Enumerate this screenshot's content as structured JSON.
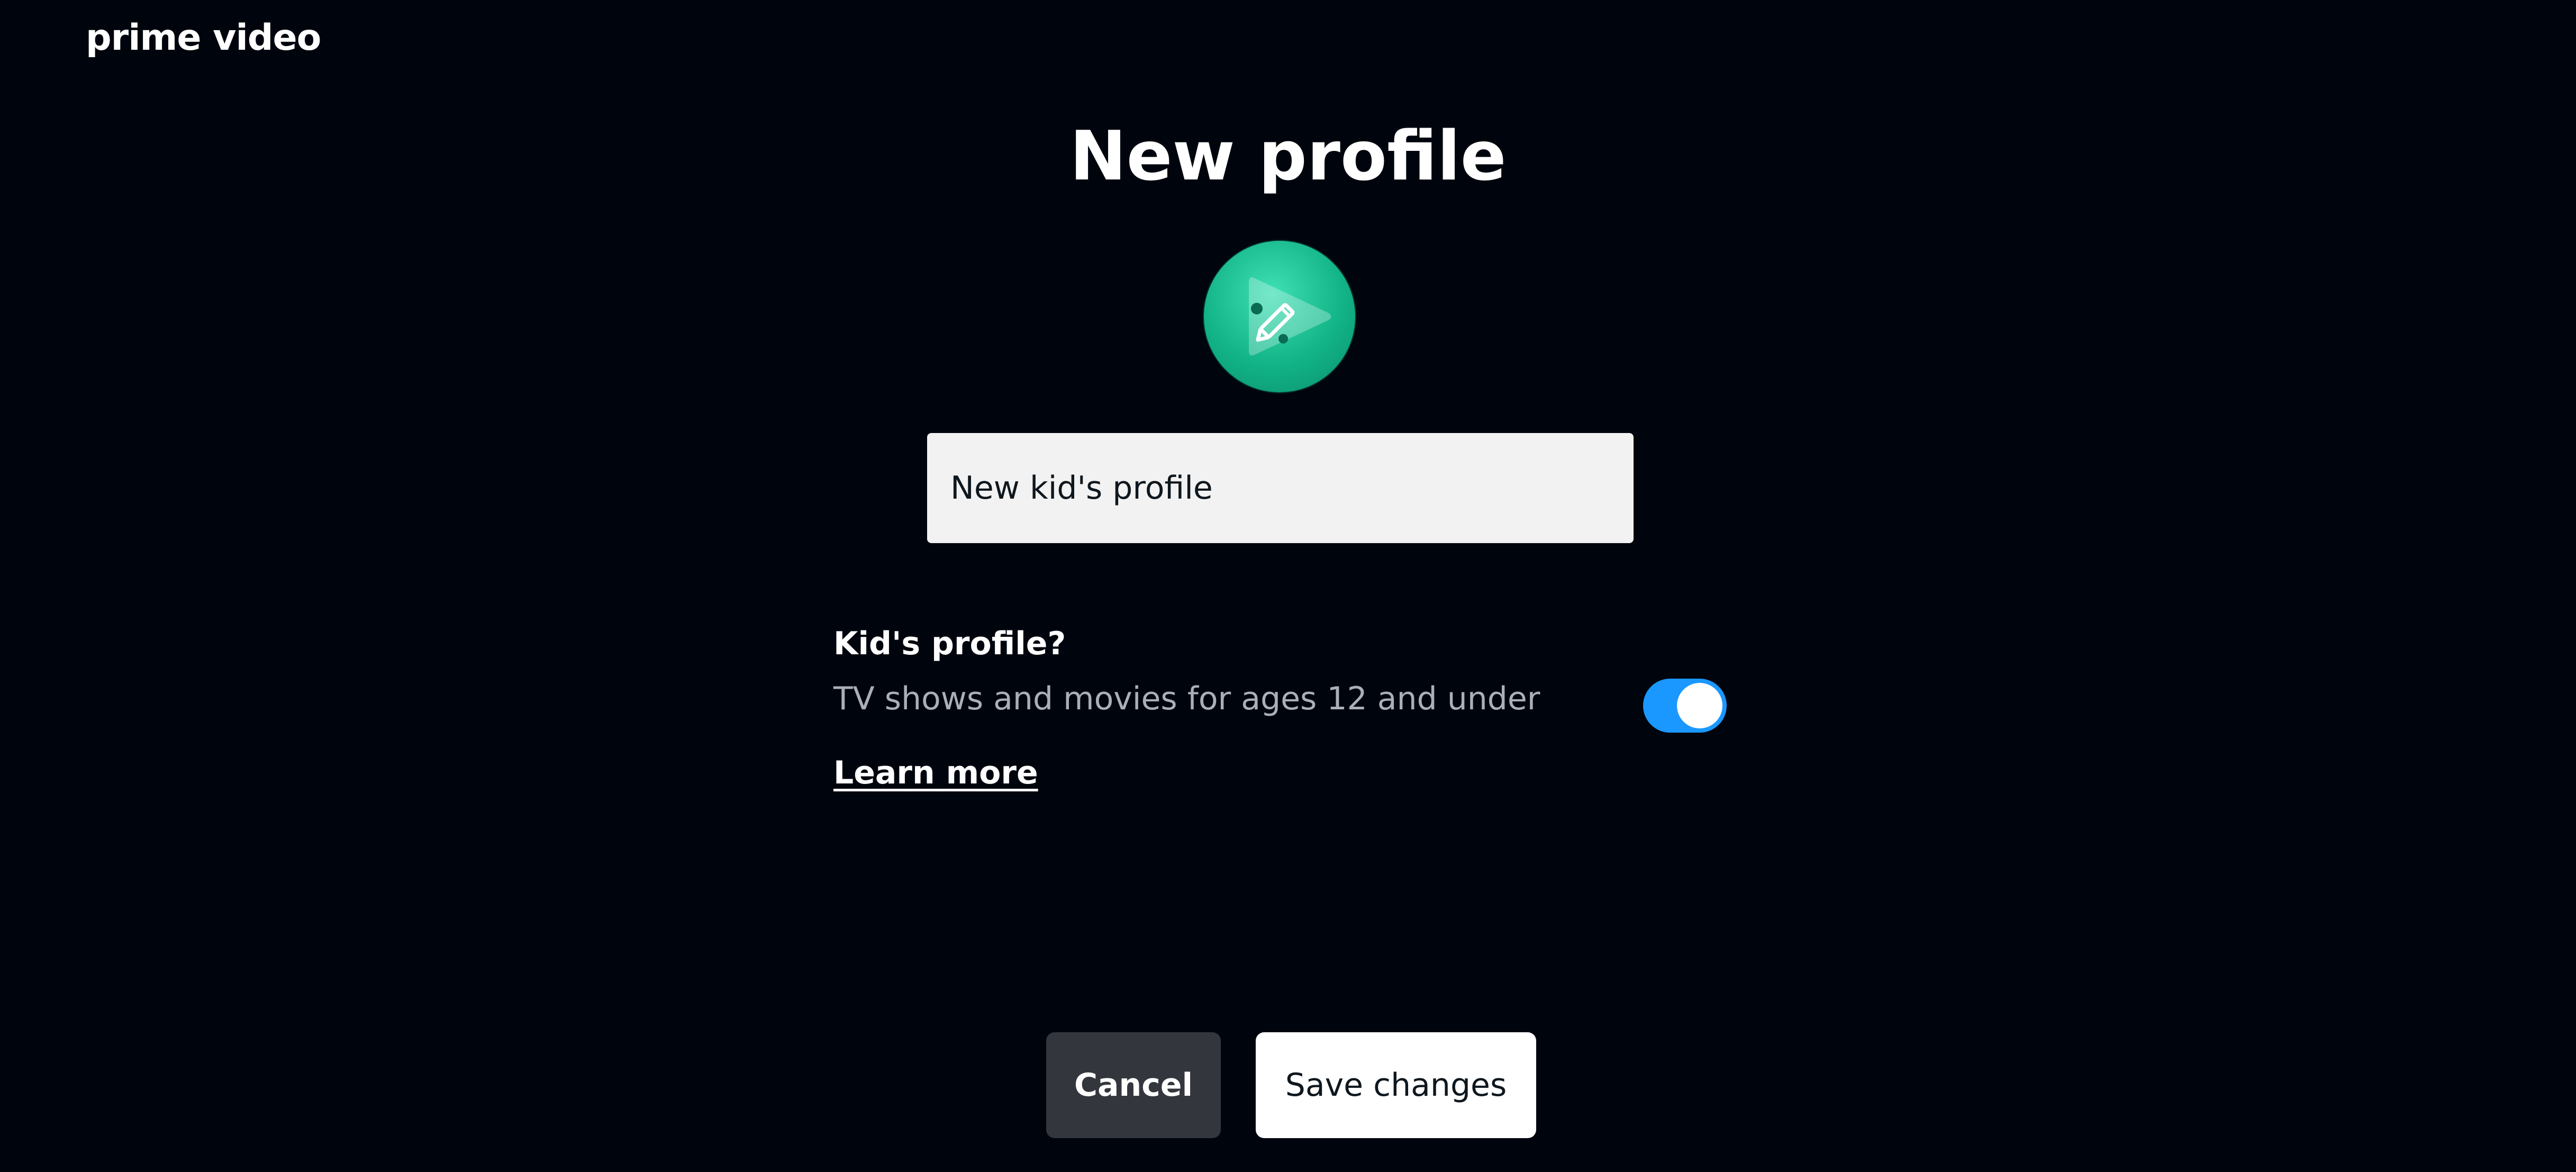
{
  "header": {
    "logo_text": "prime video"
  },
  "page": {
    "title": "New profile"
  },
  "avatar": {
    "icon": "pencil-edit-icon",
    "color": "#14b88a"
  },
  "profile_name": {
    "value": "New kid's profile"
  },
  "kids_profile": {
    "title": "Kid's profile?",
    "description": "TV shows and movies for ages 12 and under",
    "toggle_on": true,
    "toggle_color": "#1a98ff",
    "learn_more": "Learn more"
  },
  "actions": {
    "cancel_label": "Cancel",
    "save_label": "Save changes"
  }
}
